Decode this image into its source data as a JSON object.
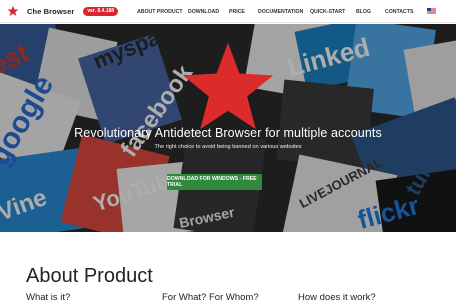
{
  "navbar": {
    "brand_name": "Che Browser",
    "version": "ver. 8.4.188",
    "links": [
      "ABOUT PRODUCT",
      "DOWNLOAD",
      "PRICE",
      "DOCUMENTATION",
      "QUICK-START",
      "BLOG",
      "CONTACTS"
    ],
    "language_flag": "us-flag-icon"
  },
  "hero": {
    "title": "Revolutionary Antidetect Browser for multiple accounts",
    "subtitle": "The right choice to avoid being banned on various websites",
    "cta_label": "DOWNLOAD FOR WINDOWS - FREE TRIAL",
    "background_words": [
      "google",
      "myspace",
      "facebook",
      "Linked",
      "YouTube",
      "flickr",
      "LIVEJOURNAL",
      "tumblr",
      "Browser",
      "Vine",
      "est"
    ]
  },
  "about": {
    "title": "About Product",
    "columns": [
      "What is it?",
      "For What? For Whom?",
      "How does it work?"
    ]
  },
  "colors": {
    "brand_red": "#d9262e",
    "cta_green": "#2f8a3b"
  }
}
